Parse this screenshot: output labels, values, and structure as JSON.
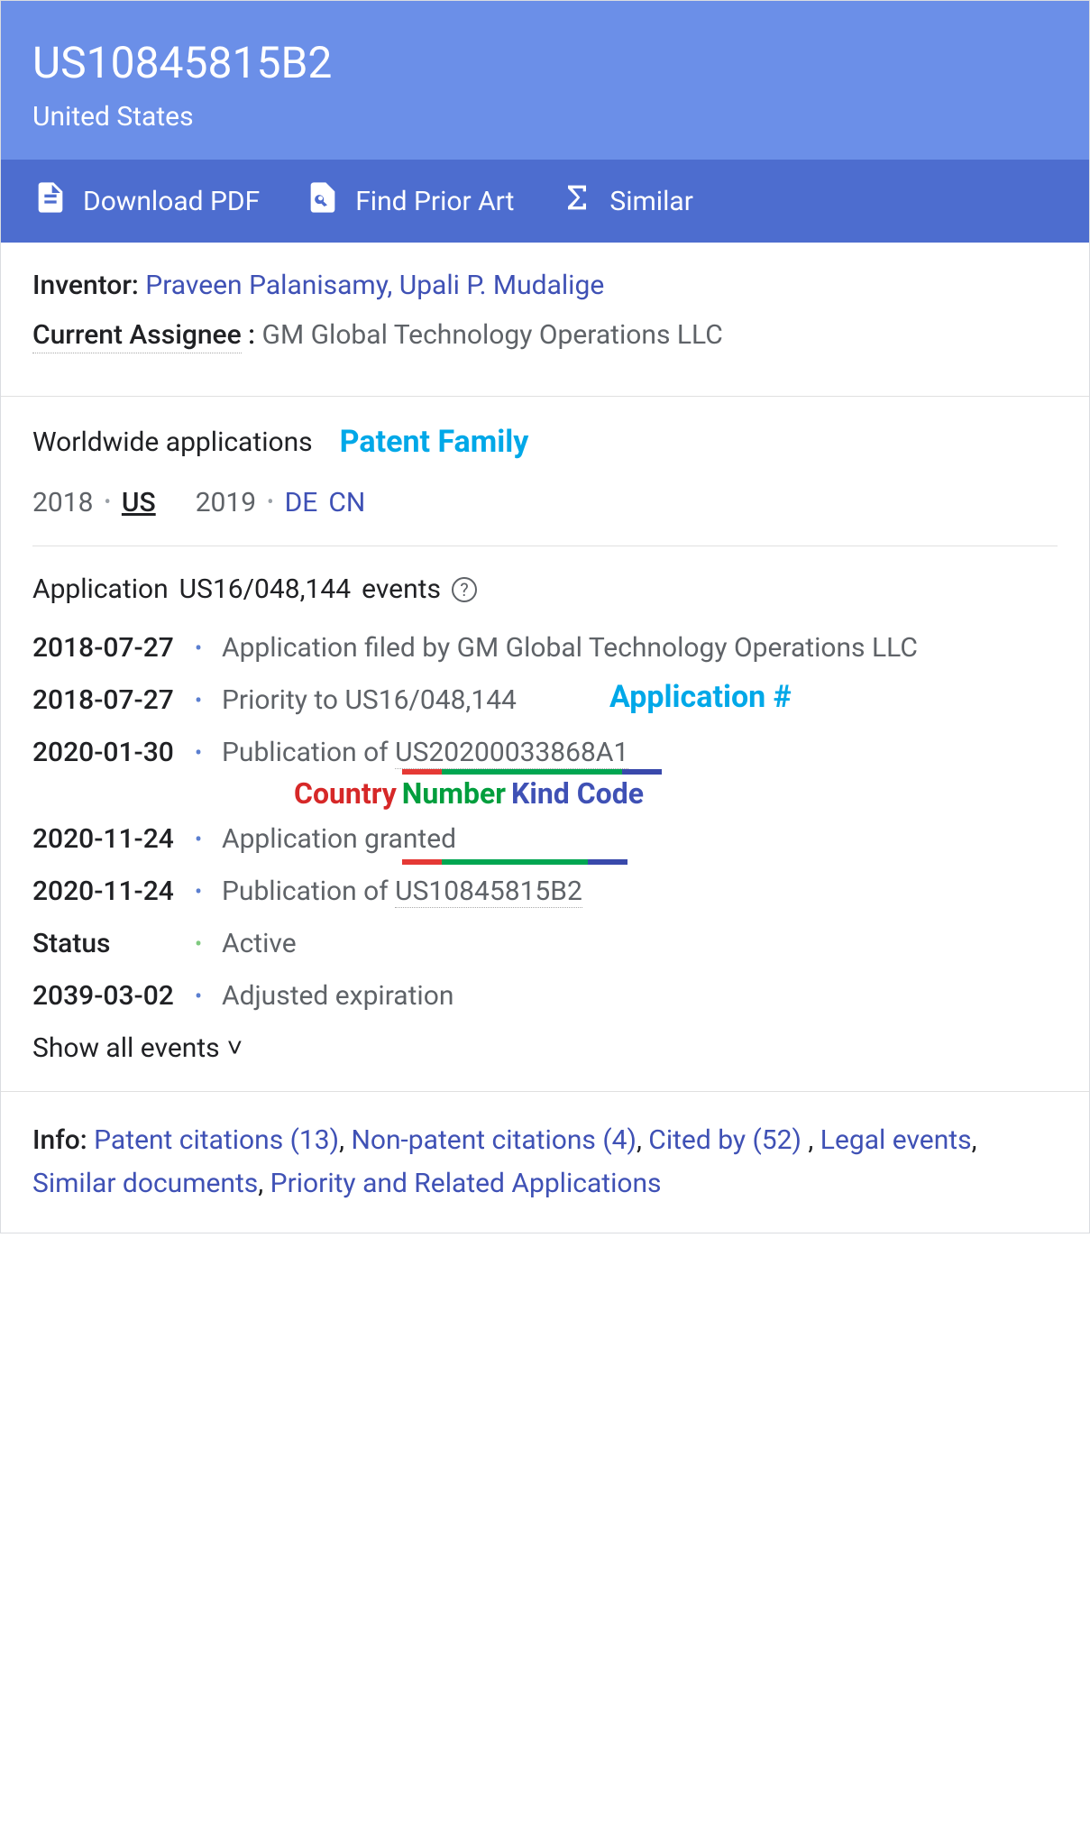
{
  "header": {
    "title": "US10845815B2",
    "subtitle": "United States"
  },
  "toolbar": {
    "download_pdf": "Download PDF",
    "find_prior_art": "Find Prior Art",
    "similar": "Similar"
  },
  "meta": {
    "inventor_label": "Inventor:",
    "inventors": [
      "Praveen Palanisamy",
      "Upali P. Mudalige"
    ],
    "assignee_label": "Current Assignee",
    "assignee_colon": ":",
    "assignee_value": "GM Global Technology Operations LLC"
  },
  "worldwide": {
    "title": "Worldwide applications",
    "annotation": "Patent Family",
    "groups": [
      {
        "year": "2018",
        "countries": [
          {
            "code": "US",
            "active": true
          }
        ]
      },
      {
        "year": "2019",
        "countries": [
          {
            "code": "DE",
            "active": false
          },
          {
            "code": "CN",
            "active": false
          }
        ]
      }
    ]
  },
  "events": {
    "title_prefix": "Application",
    "application_number": "US16/048,144",
    "title_suffix": "events",
    "help": "?",
    "annotation_app": "Application #",
    "annotation_country": "Country",
    "annotation_number": "Number",
    "annotation_kind": "Kind Code",
    "rows": [
      {
        "date": "2018-07-27",
        "desc": "Application filed by GM Global Technology Operations LLC"
      },
      {
        "date": "2018-07-27",
        "desc": "Priority to US16/048,144"
      },
      {
        "date": "2020-01-30",
        "desc_prefix": "Publication of ",
        "pub": "US20200033868A1"
      },
      {
        "date": "2020-11-24",
        "desc": "Application granted"
      },
      {
        "date": "2020-11-24",
        "desc_prefix": "Publication of ",
        "pub": "US10845815B2"
      },
      {
        "date": "Status",
        "desc": "Active",
        "green": true
      },
      {
        "date": "2039-03-02",
        "desc": "Adjusted expiration"
      }
    ],
    "show_all": "Show all events"
  },
  "info": {
    "label": "Info:",
    "links": [
      "Patent citations (13)",
      "Non-patent citations (4)",
      "Cited by (52)",
      "Legal events",
      "Similar documents",
      "Priority and Related Applications"
    ]
  }
}
